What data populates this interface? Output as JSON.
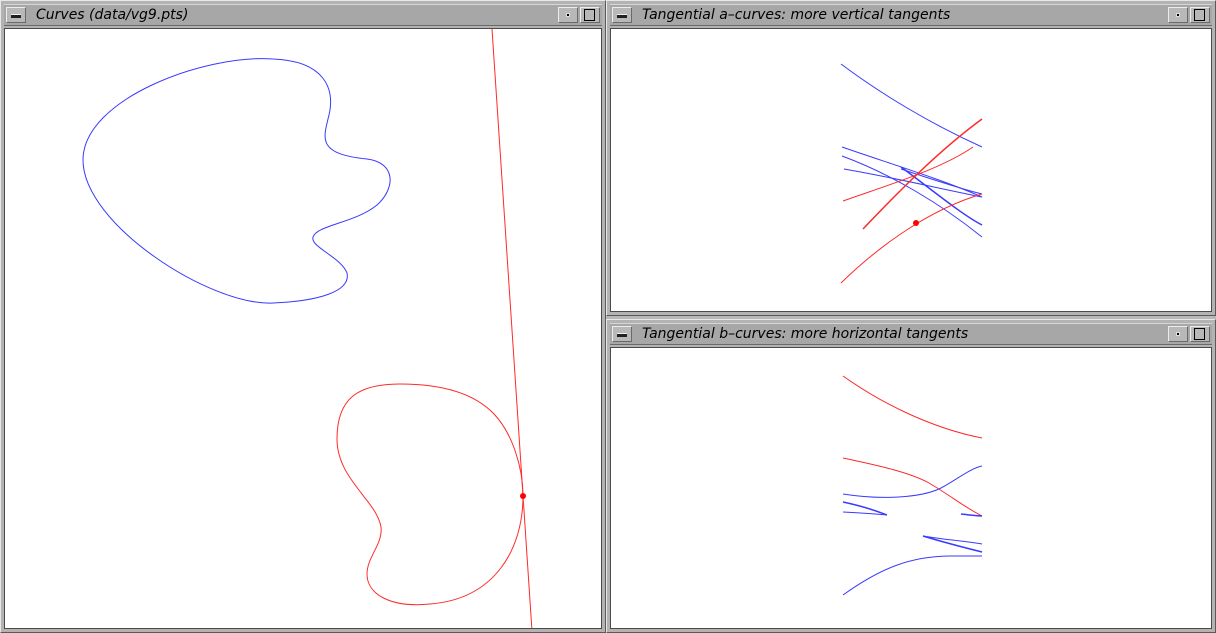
{
  "windows": {
    "curves": {
      "title": "Curves (data/vg9.pts)"
    },
    "a_curves": {
      "title": "Tangential a–curves: more vertical tangents"
    },
    "b_curves": {
      "title": "Tangential b–curves: more horizontal tangents"
    }
  },
  "icons": {
    "window_menu": "window-menu-icon",
    "minimize": "minimize-icon",
    "maximize": "maximize-icon"
  },
  "colors": {
    "curve_a": "#3a3aff",
    "curve_b": "#ff2a2a",
    "background": "#ffffff",
    "frame": "#b3b3b3"
  }
}
